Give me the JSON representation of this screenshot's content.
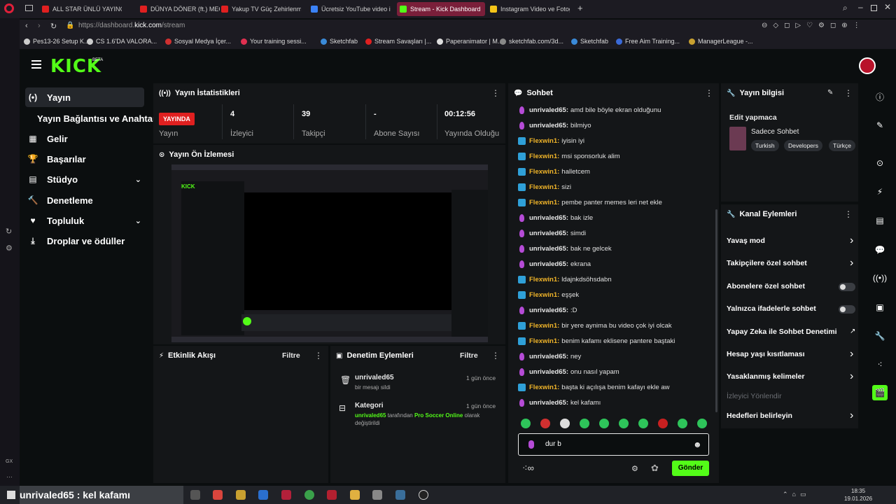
{
  "browser": {
    "tabs": [
      {
        "title": "ALL STAR ÜNLÜ YAYINCIL",
        "color": "#e02020"
      },
      {
        "title": "DÜNYA DÖNER (ft.) MEG",
        "color": "#e02020"
      },
      {
        "title": "Yakup TV Güç Zehirlenme",
        "color": "#e02020"
      },
      {
        "title": "Ücretsiz YouTube video in",
        "color": "#3b82f6"
      },
      {
        "title": "Stream - Kick Dashboard",
        "color": "#53fc18",
        "active": true
      },
      {
        "title": "Instagram Video ve Fotoğr",
        "color": "#f5c518"
      }
    ],
    "url_prefix": "https://dashboard.",
    "url_domain": "kick.com",
    "url_path": "/stream",
    "bookmarks": [
      "Pes13-26 Setup K...",
      "CS 1.6'DA VALORA...",
      "Sosyal Medya İçer...",
      "Your training sessi...",
      "Sketchfab",
      "Stream Savaşları |...",
      "Paperanimator | M...",
      "sketchfab.com/3d...",
      "Sketchfab",
      "Free Aim Training...",
      "ManagerLeague -..."
    ]
  },
  "header": {
    "logo": "KICK",
    "beta": "BETA"
  },
  "sidebar": {
    "items": [
      {
        "label": "Yayın",
        "icon": "(•)",
        "selected": true
      },
      {
        "label": "Yayın Bağlantısı ve Anahtarı",
        "icon": ""
      },
      {
        "label": "Gelir",
        "icon": "▦"
      },
      {
        "label": "Başarılar",
        "icon": "🏆"
      },
      {
        "label": "Stüdyo",
        "icon": "▤",
        "chevron": "⌄"
      },
      {
        "label": "Denetleme",
        "icon": "🔨"
      },
      {
        "label": "Topluluk",
        "icon": "♥",
        "chevron": "⌄"
      },
      {
        "label": "Droplar ve ödüller",
        "icon": "⤓"
      }
    ]
  },
  "stats": {
    "title": "Yayın İstatistikleri",
    "status_badge": "YAYINDA",
    "status_label": "Yayın",
    "viewers_value": "4",
    "viewers_label": "İzleyici",
    "followers_value": "39",
    "followers_label": "Takipçi",
    "subs_value": "-",
    "subs_label": "Abone Sayısı",
    "uptime_value": "00:12:56",
    "uptime_label": "Yayında Olduğu"
  },
  "preview": {
    "title": "Yayın Ön İzlemesi"
  },
  "activity": {
    "title": "Etkinlik Akışı",
    "filter": "Filtre"
  },
  "moderation": {
    "title": "Denetim Eylemleri",
    "filter": "Filtre",
    "items": [
      {
        "user": "unrivaled65",
        "time": "1 gün önce",
        "desc": "bir mesajı sildi"
      },
      {
        "title": "Kategori",
        "time": "1 gün önce",
        "user": "unrivaled65",
        "mid": " tarafından ",
        "category": "Pro Soccer Online",
        "end": " olarak",
        "desc2": "değiştirildi"
      }
    ]
  },
  "chat": {
    "title": "Sohbet",
    "messages": [
      {
        "user": "unrivaled65",
        "text": "amd bile böyle ekran olduğunu",
        "badge": "mic"
      },
      {
        "user": "unrivaled65",
        "text": "bilmiyo",
        "badge": "mic"
      },
      {
        "user": "Flexwin1",
        "text": "iyisin iyi",
        "badge": "kick"
      },
      {
        "user": "Flexwin1",
        "text": "msi sponsorluk alim",
        "badge": "kick"
      },
      {
        "user": "Flexwin1",
        "text": "halletcem",
        "badge": "kick"
      },
      {
        "user": "Flexwin1",
        "text": "sizi",
        "badge": "kick"
      },
      {
        "user": "Flexwin1",
        "text": "pembe panter memes leri net ekle",
        "badge": "kick"
      },
      {
        "user": "unrivaled65",
        "text": "bak izle",
        "badge": "mic"
      },
      {
        "user": "unrivaled65",
        "text": "simdi",
        "badge": "mic"
      },
      {
        "user": "unrivaled65",
        "text": "bak ne gelcek",
        "badge": "mic"
      },
      {
        "user": "unrivaled65",
        "text": "ekrana",
        "badge": "mic"
      },
      {
        "user": "Flexwin1",
        "text": "ldajnkdsöhsdabn",
        "badge": "kick"
      },
      {
        "user": "Flexwin1",
        "text": "eşşek",
        "badge": "kick"
      },
      {
        "user": "unrivaled65",
        "text": ":D",
        "badge": "mic"
      },
      {
        "user": "Flexwin1",
        "text": "bir yere aynima bu video çok iyi olcak",
        "badge": "kick"
      },
      {
        "user": "Flexwin1",
        "text": "benim kafamı eklisene pantere baştaki",
        "badge": "kick"
      },
      {
        "user": "unrivaled65",
        "text": "ney",
        "badge": "mic"
      },
      {
        "user": "unrivaled65",
        "text": "onu nasıl yapam",
        "badge": "mic"
      },
      {
        "user": "Flexwin1",
        "text": "başta ki açılışa benim kafayı ekle aw",
        "badge": "kick"
      },
      {
        "user": "unrivaled65",
        "text": "kel kafamı",
        "badge": "mic"
      }
    ],
    "input_value": "dur b",
    "send_label": "Gönder",
    "colors": {
      "unrivaled65": "#e8e8e8",
      "Flexwin1": "#f0b429"
    }
  },
  "stream_info": {
    "title": "Yayın bilgisi",
    "edit_label": "Edit yapmaca",
    "category": "Sadece Sohbet",
    "tags": [
      "Turkish",
      "Developers",
      "Türkçe"
    ]
  },
  "channel_actions": {
    "title": "Kanal Eylemleri",
    "items": [
      {
        "label": "Yavaş mod",
        "control": "chevron"
      },
      {
        "label": "Takipçilere özel sohbet",
        "control": "chevron"
      },
      {
        "label": "Abonelere özel sohbet",
        "control": "toggle"
      },
      {
        "label": "Yalnızca ifadelerle sohbet",
        "control": "toggle"
      },
      {
        "label": "Yapay Zeka ile Sohbet Denetimi",
        "control": "external"
      },
      {
        "label": "Hesap yaşı kısıtlaması",
        "control": "chevron"
      },
      {
        "label": "Yasaklanmış kelimeler",
        "control": "chevron"
      },
      {
        "label": "İzleyici Yönlendir",
        "control": "none",
        "dim": true
      },
      {
        "label": "Hedefleri belirleyin",
        "control": "chevron"
      }
    ]
  },
  "taskbar": {
    "banner": "unrivaled65 : kel kafamı",
    "time": "18:35",
    "date": "19.01.2026"
  },
  "accent": "#53fc18"
}
